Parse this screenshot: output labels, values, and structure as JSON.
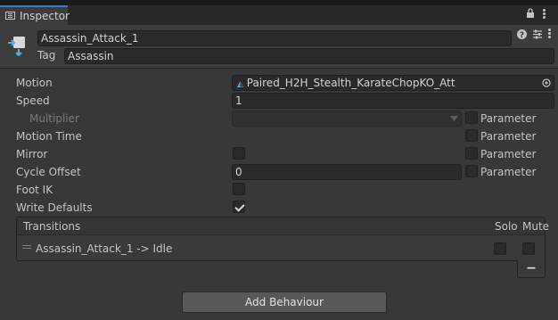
{
  "tab": {
    "title": "Inspector"
  },
  "header": {
    "name_value": "Assassin_Attack_1",
    "tag_label": "Tag",
    "tag_value": "Assassin"
  },
  "properties": {
    "motion_label": "Motion",
    "motion_value": "Paired_H2H_Stealth_KarateChopKO_Att",
    "speed_label": "Speed",
    "speed_value": "1",
    "multiplier_label": "Multiplier",
    "motion_time_label": "Motion Time",
    "mirror_label": "Mirror",
    "cycle_offset_label": "Cycle Offset",
    "cycle_offset_value": "0",
    "foot_ik_label": "Foot IK",
    "write_defaults_label": "Write Defaults",
    "parameter_label": "Parameter"
  },
  "state": {
    "mirror": false,
    "foot_ik": false,
    "write_defaults": true,
    "multiplier_param": false,
    "motion_time_param": false,
    "mirror_param": false,
    "cycle_offset_param": false
  },
  "transitions": {
    "header": "Transitions",
    "solo_label": "Solo",
    "mute_label": "Mute",
    "items": [
      {
        "label": "Assassin_Attack_1 -> Idle",
        "solo": false,
        "mute": false
      }
    ],
    "remove_label": "−"
  },
  "footer": {
    "add_behaviour_label": "Add Behaviour"
  },
  "icons": [
    "inspector-icon",
    "lock-icon",
    "menu-icon",
    "animator-state-icon",
    "help-icon",
    "settings-icon",
    "anim-clip-icon",
    "object-picker-icon",
    "dropdown-arrow-icon",
    "drag-handle-icon"
  ],
  "colors": {
    "background": "#383838",
    "field": "#2a2a2a",
    "accent": "#3a79bb"
  }
}
